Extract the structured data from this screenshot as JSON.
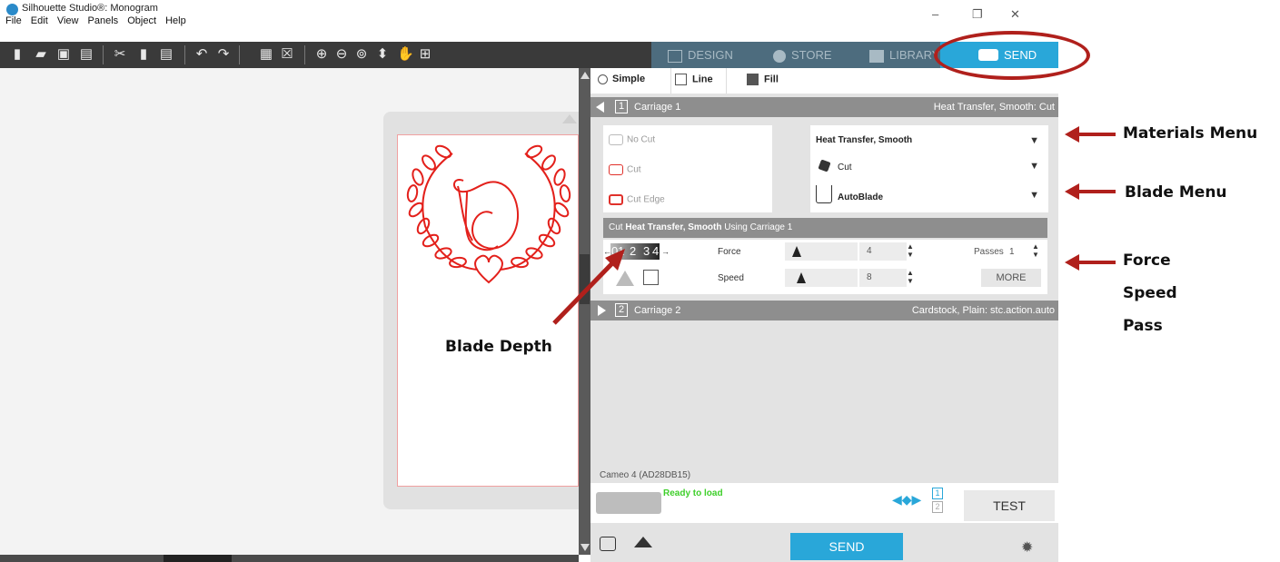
{
  "window": {
    "title": "Silhouette Studio®: Monogram",
    "controls": [
      "–",
      "❐",
      "✕"
    ]
  },
  "menu": [
    "File",
    "Edit",
    "View",
    "Panels",
    "Object",
    "Help"
  ],
  "nav": {
    "design": "DESIGN",
    "store": "STORE",
    "library": "LIBRARY",
    "send": "SEND"
  },
  "tabs": {
    "simple": "Simple",
    "line": "Line",
    "fill": "Fill"
  },
  "carriage1": {
    "index": "1",
    "label": "Carriage 1",
    "material_summary": "Heat Transfer, Smooth: Cut"
  },
  "cut_options": {
    "no_cut": "No Cut",
    "cut": "Cut",
    "cut_edge": "Cut Edge"
  },
  "material_menu": {
    "value": "Heat Transfer, Smooth"
  },
  "action_menu": {
    "value": "Cut"
  },
  "blade_menu": {
    "value": "AutoBlade"
  },
  "using": {
    "prefix": "Cut",
    "material": "Heat Transfer, Smooth",
    "suffix": "Using Carriage 1"
  },
  "blade_depth": {
    "digits": [
      "0",
      "1",
      "2",
      "3",
      "4"
    ],
    "left_arrow": "←",
    "right_arrow": "→"
  },
  "force": {
    "label": "Force",
    "value": "4",
    "level": 0.12
  },
  "speed": {
    "label": "Speed",
    "value": "8",
    "level": 0.18
  },
  "passes": {
    "label": "Passes",
    "value": "1"
  },
  "more_button": "MORE",
  "carriage2": {
    "index": "2",
    "label": "Carriage 2",
    "material_summary": "Cardstock, Plain: stc.action.auto"
  },
  "device": {
    "name": "Cameo 4 (AD28DB15)",
    "status": "Ready to load",
    "carriage_1": "1",
    "carriage_2": "2"
  },
  "test_button": "TEST",
  "send_button": "SEND",
  "annotations": {
    "materials_menu": "Materials Menu",
    "blade_menu": "Blade Menu",
    "force": "Force",
    "speed": "Speed",
    "pass": "Pass",
    "blade_depth": "Blade Depth"
  },
  "colors": {
    "accent": "#29a7d9",
    "annotation": "#b0201c",
    "status_ok": "#3ecf2a"
  }
}
